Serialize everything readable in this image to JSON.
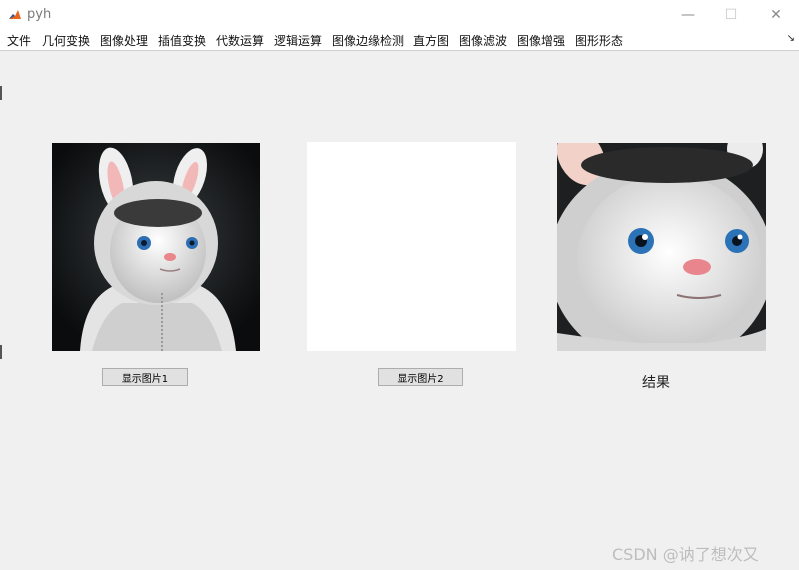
{
  "window": {
    "title": "pyh",
    "minimize_symbol": "—",
    "maximize_symbol": "☐",
    "close_symbol": "✕"
  },
  "menu": {
    "items": [
      {
        "label": "文件"
      },
      {
        "label": "几何变换"
      },
      {
        "label": "图像处理"
      },
      {
        "label": "插值变换"
      },
      {
        "label": "代数运算"
      },
      {
        "label": "逻辑运算"
      },
      {
        "label": "图像边缘检测"
      },
      {
        "label": "直方图"
      },
      {
        "label": "图像滤波"
      },
      {
        "label": "图像增强"
      },
      {
        "label": "图形形态"
      }
    ],
    "overflow_symbol": "↘"
  },
  "main": {
    "show_image1_label": "显示图片1",
    "show_image2_label": "显示图片2",
    "result_label": "结果"
  },
  "watermark": "CSDN @讷了想次又",
  "colors": {
    "window_bg": "#f0f0f0",
    "titlebar_bg": "#ffffff",
    "button_bg": "#e1e1e1",
    "button_border": "#adadad"
  },
  "icons": {
    "app": "matlab-icon",
    "image1": "bunny-image-1",
    "image3": "bunny-image-closeup"
  }
}
